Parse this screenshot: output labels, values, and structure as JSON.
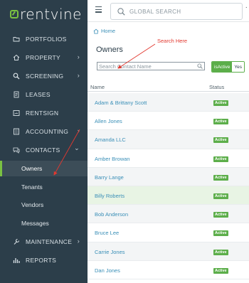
{
  "app": {
    "brand": "rentvine"
  },
  "colors": {
    "sidebar": "#2c3e4a",
    "accent": "#7ac142",
    "link": "#3a8fb7",
    "badge": "#5cae4a",
    "annotation": "#e2382f"
  },
  "sidebar": {
    "items": [
      {
        "label": "PORTFOLIOS",
        "icon": "folder-icon",
        "chevron": ""
      },
      {
        "label": "PROPERTY",
        "icon": "home-icon",
        "chevron": "›"
      },
      {
        "label": "SCREENING",
        "icon": "magnify-icon",
        "chevron": "›"
      },
      {
        "label": "LEASES",
        "icon": "document-icon",
        "chevron": ""
      },
      {
        "label": "RENTSIGN",
        "icon": "signature-icon",
        "chevron": ""
      },
      {
        "label": "ACCOUNTING",
        "icon": "ledger-icon",
        "chevron": "›"
      },
      {
        "label": "CONTACTS",
        "icon": "contacts-icon",
        "chevron": "⌄"
      },
      {
        "label": "MAINTENANCE",
        "icon": "wrench-icon",
        "chevron": "›"
      },
      {
        "label": "REPORTS",
        "icon": "chart-icon",
        "chevron": ""
      }
    ],
    "contacts_sub": [
      {
        "label": "Owners",
        "active": true
      },
      {
        "label": "Tenants",
        "active": false
      },
      {
        "label": "Vendors",
        "active": false
      },
      {
        "label": "Messages",
        "active": false
      }
    ]
  },
  "topbar": {
    "search_placeholder": "GLOBAL SEARCH",
    "more": "·"
  },
  "main": {
    "breadcrumb": "Home",
    "title": "Owners",
    "search_placeholder": "Search Contact Name",
    "toggle_on": "isActive",
    "toggle_off": "Yes",
    "annotation": "Search Here",
    "columns": {
      "name": "Name",
      "status": "Status"
    },
    "rows": [
      {
        "name": "Adam & Brittany Scott",
        "status": "Active"
      },
      {
        "name": "Allen Jones",
        "status": "Active"
      },
      {
        "name": "Amanda LLC",
        "status": "Active"
      },
      {
        "name": "Amber Browan",
        "status": "Active"
      },
      {
        "name": "Barry Lange",
        "status": "Active"
      },
      {
        "name": "Billy Roberts",
        "status": "Active"
      },
      {
        "name": "Bob Anderson",
        "status": "Active"
      },
      {
        "name": "Bruce Lee",
        "status": "Active"
      },
      {
        "name": "Carrie Jones",
        "status": "Active"
      },
      {
        "name": "Dan Jones",
        "status": "Active"
      }
    ]
  }
}
